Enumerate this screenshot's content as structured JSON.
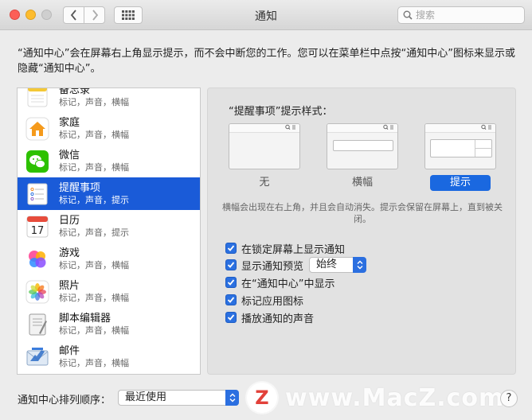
{
  "window": {
    "title": "通知"
  },
  "search": {
    "placeholder": "搜索"
  },
  "description": "“通知中心”会在屏幕右上角显示提示，而不会中断您的工作。您可以在菜单栏中点按“通知中心”图标来显示或隐藏“通知中心”。",
  "apps": [
    {
      "name": "备忘录",
      "sub": "标记，声音，横幅",
      "icon": "notes-icon"
    },
    {
      "name": "家庭",
      "sub": "标记，声音，横幅",
      "icon": "home-icon"
    },
    {
      "name": "微信",
      "sub": "标记，声音，横幅",
      "icon": "wechat-icon"
    },
    {
      "name": "提醒事项",
      "sub": "标记，声音，提示",
      "icon": "reminders-icon",
      "selected": true
    },
    {
      "name": "日历",
      "sub": "标记，声音，提示",
      "icon": "calendar-icon",
      "date": "17"
    },
    {
      "name": "游戏",
      "sub": "标记，声音，横幅",
      "icon": "game-center-icon"
    },
    {
      "name": "照片",
      "sub": "标记，声音，横幅",
      "icon": "photos-icon"
    },
    {
      "name": "脚本编辑器",
      "sub": "标记，声音，横幅",
      "icon": "script-editor-icon"
    },
    {
      "name": "邮件",
      "sub": "标记，声音，横幅",
      "icon": "mail-icon"
    }
  ],
  "panel": {
    "style_title": "“提醒事项”提示样式：",
    "styles": [
      {
        "label": "无"
      },
      {
        "label": "横幅"
      },
      {
        "label": "提示",
        "selected": true
      }
    ],
    "style_note": "横幅会出现在右上角，并且会自动消失。提示会保留在屏幕上，直到被关闭。",
    "options": [
      {
        "label": "在锁定屏幕上显示通知",
        "checked": true
      },
      {
        "label": "显示通知预览",
        "checked": true
      },
      {
        "label": "在“通知中心”中显示",
        "checked": true
      },
      {
        "label": "标记应用图标",
        "checked": true
      },
      {
        "label": "播放通知的声音",
        "checked": true
      }
    ],
    "preview_value": "始终"
  },
  "sort": {
    "label": "通知中心排列顺序：",
    "value": "最近使用"
  },
  "watermark": {
    "logo": "Z",
    "text": "www.MacZ.com"
  },
  "help": {
    "label": "?"
  }
}
